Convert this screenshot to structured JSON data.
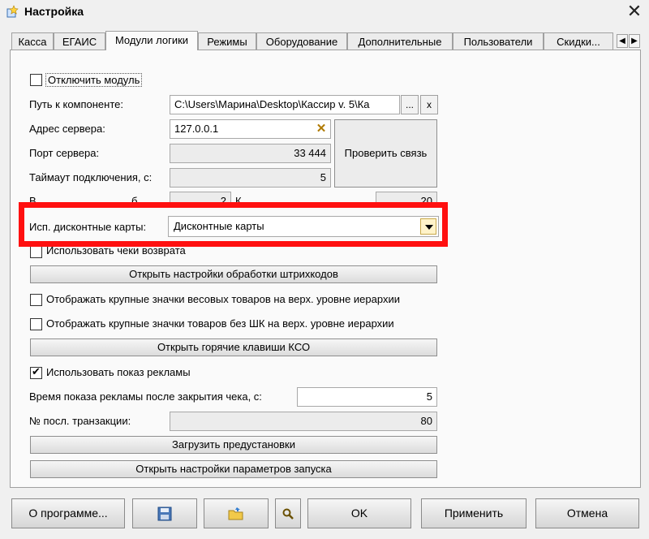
{
  "window": {
    "title": "Настройка"
  },
  "tabs": [
    "Касса",
    "ЕГАИС",
    "Модули логики",
    "Режимы",
    "Оборудование",
    "Дополнительные",
    "Пользователи",
    "Скидки..."
  ],
  "active_tab_index": 2,
  "module": {
    "disable_label": "Отключить модуль",
    "disable_checked": false,
    "path_label": "Путь к компоненте:",
    "path_value": "C:\\Users\\Марина\\Desktop\\Кассир v. 5\\Ка",
    "path_browse": "...",
    "path_clear": "x",
    "server_label": "Адрес сервера:",
    "server_value": "127.0.0.1",
    "port_label": "Порт сервера:",
    "port_value": "33 444",
    "timeout_label": "Таймаут подключения, с:",
    "timeout_value": "5",
    "check_connection": "Проверить связь",
    "partial_left_label": "В",
    "partial_left_mid": "б",
    "partial_left_value": "2",
    "partial_right_label": "К",
    "partial_right_value": "20"
  },
  "discount": {
    "label": "Исп. дисконтные карты:",
    "value": "Дисконтные карты"
  },
  "options": {
    "return_checks_label": "Использовать чеки возврата",
    "return_checks_checked": false,
    "barcode_settings": "Открыть настройки обработки штрихкодов",
    "large_weight_icons_label": "Отображать крупные значки весовых товаров на верх. уровне иерархии",
    "large_weight_icons_checked": false,
    "large_nobarcode_icons_label": "Отображать крупные значки товаров без ШК на верх. уровне иерархии",
    "large_nobarcode_icons_checked": false,
    "hotkeys": "Открыть горячие клавиши КСО",
    "ads_label": "Использовать показ рекламы",
    "ads_checked": true,
    "ads_time_label": "Время показа рекламы после закрытия чека, с:",
    "ads_time_value": "5",
    "last_tx_label": "№ посл. транзакции:",
    "last_tx_value": "80",
    "load_presets": "Загрузить предустановки",
    "launch_settings": "Открыть настройки параметров запуска"
  },
  "footer": {
    "about": "О программе...",
    "ok": "OK",
    "apply": "Применить",
    "cancel": "Отмена"
  },
  "icons": {
    "app": "settings-app-icon",
    "save": "floppy-disk-icon",
    "open": "folder-open-icon",
    "search": "magnifier-icon",
    "close": "close-icon"
  },
  "colors": {
    "highlight": "#ff1010",
    "dropdown_arrow_bg": "#fff3c9"
  }
}
